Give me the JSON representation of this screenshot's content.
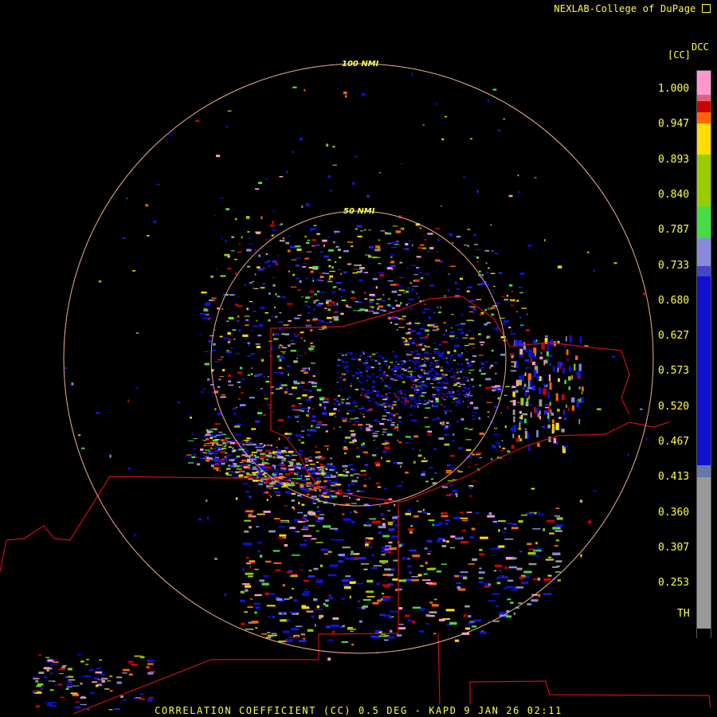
{
  "header": {
    "credit": "NEXLAB-College of DuPage"
  },
  "product": {
    "code": "DCC",
    "unit": "[CC]"
  },
  "rings": [
    {
      "label": "100 NMI"
    },
    {
      "label": "50 NMI"
    }
  ],
  "colorbar": {
    "labels": [
      "1.000",
      "0.947",
      "0.893",
      "0.840",
      "0.787",
      "0.733",
      "0.680",
      "0.627",
      "0.573",
      "0.520",
      "0.467",
      "0.413",
      "0.360",
      "0.307",
      "0.253",
      "TH"
    ],
    "colors": {
      "pink_top": "#ff99cc",
      "magenta": "#e0607a",
      "red": "#cc0000",
      "orange": "#ff6600",
      "yellow": "#ffdd00",
      "yellowgreen": "#99cc00",
      "green": "#44dd44",
      "lavender": "#8888dd",
      "blue": "#1111cc",
      "grey": "#999999",
      "black": "#000000"
    }
  },
  "footer": {
    "caption": "CORRELATION COEFFICIENT (CC) 0.5 DEG - KAPD 9 JAN 26 02:11"
  }
}
